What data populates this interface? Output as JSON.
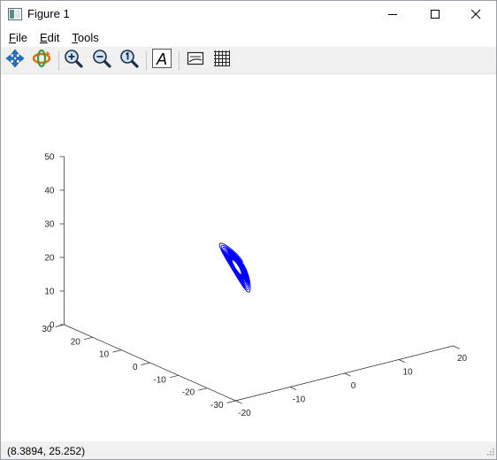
{
  "window": {
    "title": "Figure 1",
    "controls": {
      "minimize": "minimize-icon",
      "maximize": "maximize-icon",
      "close": "close-icon"
    }
  },
  "menu": [
    {
      "label": "File",
      "accel": "F",
      "rest": "ile"
    },
    {
      "label": "Edit",
      "accel": "E",
      "rest": "dit"
    },
    {
      "label": "Tools",
      "accel": "T",
      "rest": "ools"
    }
  ],
  "toolbar": {
    "buttons": [
      "pan-icon",
      "rotate-icon",
      "zoom-in-icon",
      "zoom-out-icon",
      "zoom-reset-icon",
      "text-icon",
      "legend-icon",
      "grid-icon"
    ],
    "text_tool_glyph": "A"
  },
  "status": {
    "coordinates": "(8.3894, 25.252)"
  },
  "colors": {
    "line": "#0000ff",
    "axis": "#262626",
    "toolbar_bg": "#f0f0f0"
  },
  "chart_data": {
    "type": "line",
    "projection": "3d",
    "series_color": "#0000ff",
    "x_ticks": [
      "-20",
      "-10",
      "0",
      "10",
      "20"
    ],
    "y_ticks": [
      "-30",
      "-20",
      "-10",
      "0",
      "10",
      "20",
      "30"
    ],
    "z_ticks": [
      "0",
      "10",
      "20",
      "30",
      "40",
      "50"
    ],
    "xlim": [
      -20,
      20
    ],
    "ylim": [
      -30,
      30
    ],
    "zlim": [
      0,
      50
    ],
    "grid": false,
    "title": "",
    "xlabel": "",
    "ylabel": "",
    "zlabel": ""
  }
}
